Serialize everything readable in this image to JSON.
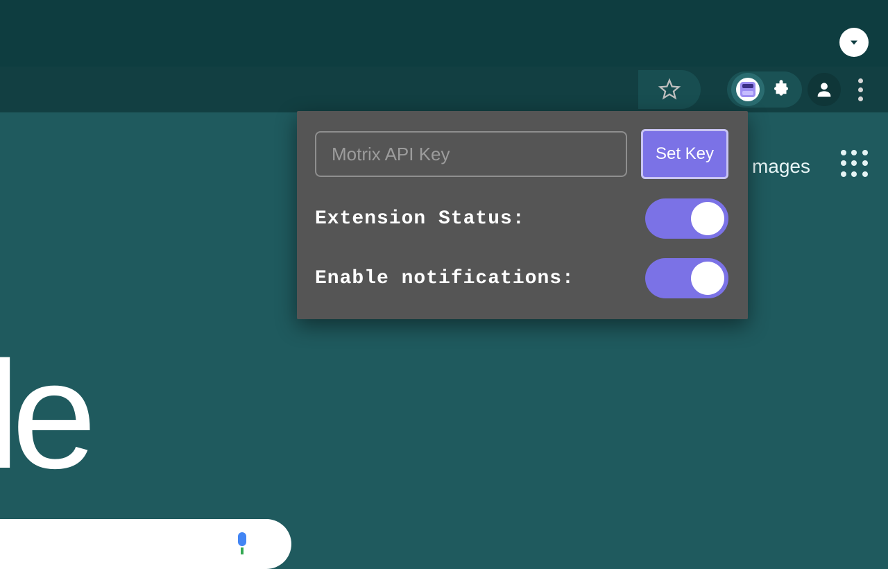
{
  "title_bar": {
    "dropdown_icon": "caret-down-icon"
  },
  "toolbar": {
    "bookmark_icon": "star-icon",
    "active_extension_icon": "motrix-extension-icon",
    "extensions_icon": "puzzle-piece-icon",
    "profile_icon": "person-icon",
    "menu_icon": "kebab-menu-icon"
  },
  "page": {
    "nav_images_label": "mages",
    "apps_icon": "apps-grid-icon",
    "logo_fragment": "le",
    "mic_icon": "microphone-icon"
  },
  "popup": {
    "api_key_placeholder": "Motrix API Key",
    "api_key_value": "",
    "set_key_label": "Set Key",
    "rows": [
      {
        "label": "Extension Status:",
        "on": true
      },
      {
        "label": "Enable notifications:",
        "on": true
      }
    ]
  },
  "colors": {
    "accent": "#7b72e6",
    "background": "#1f5a5e",
    "popup": "#555555"
  }
}
